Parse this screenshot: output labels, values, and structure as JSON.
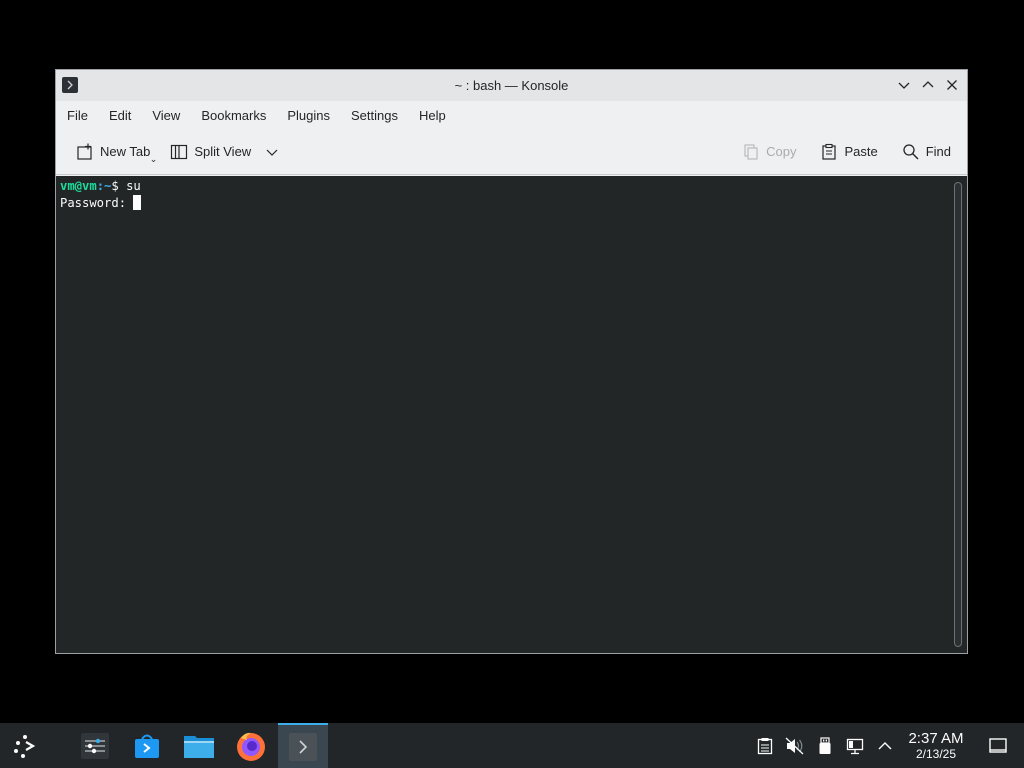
{
  "window": {
    "title": "~ : bash — Konsole"
  },
  "menubar": {
    "items": [
      {
        "label": "File"
      },
      {
        "label": "Edit"
      },
      {
        "label": "View"
      },
      {
        "label": "Bookmarks"
      },
      {
        "label": "Plugins"
      },
      {
        "label": "Settings"
      },
      {
        "label": "Help"
      }
    ]
  },
  "toolbar": {
    "new_tab": "New Tab",
    "split_view": "Split View",
    "copy": "Copy",
    "paste": "Paste",
    "find": "Find"
  },
  "terminal": {
    "prompt_user": "vm@vm",
    "prompt_path": ":~",
    "prompt_symbol": "$ ",
    "command": "su",
    "password_prompt": "Password: "
  },
  "taskbar": {
    "items": [
      {
        "icon": "app-launcher-icon"
      },
      {
        "icon": "system-settings-icon"
      },
      {
        "icon": "discover-store-icon"
      },
      {
        "icon": "file-manager-icon"
      },
      {
        "icon": "firefox-icon"
      },
      {
        "icon": "konsole-icon",
        "active": true
      }
    ],
    "tray_icons": [
      "clipboard-icon",
      "volume-muted-icon",
      "usb-device-icon",
      "network-icon",
      "expand-tray-icon"
    ],
    "clock_time": "2:37 AM",
    "clock_date": "2/13/25"
  },
  "colors": {
    "accent": "#3daee9",
    "prompt_user": "#1cdc9a",
    "terminal_bg": "#232627"
  }
}
